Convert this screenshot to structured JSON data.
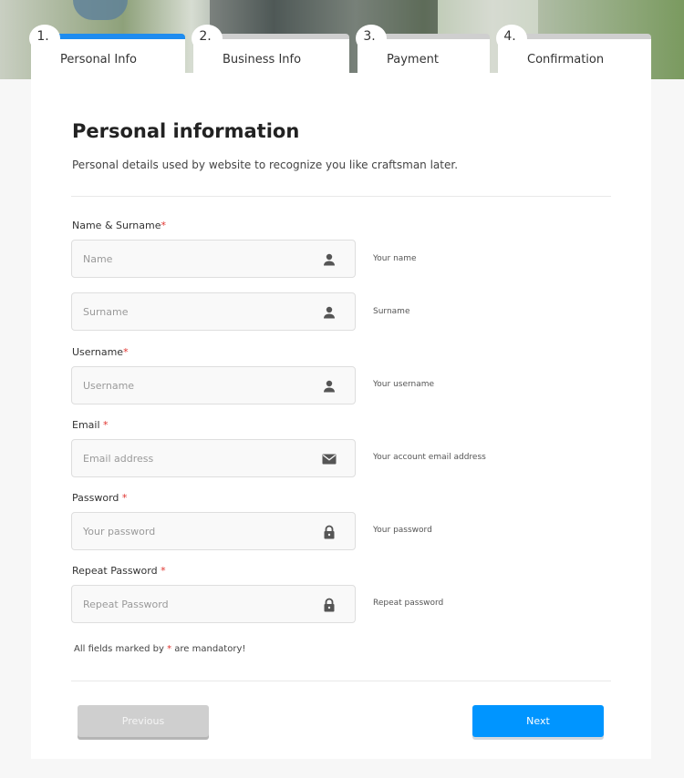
{
  "steps": [
    {
      "number": "1.",
      "label": "Personal Info",
      "active": true
    },
    {
      "number": "2.",
      "label": "Business Info",
      "active": false
    },
    {
      "number": "3.",
      "label": "Payment",
      "active": false
    },
    {
      "number": "4.",
      "label": "Confirmation",
      "active": false
    }
  ],
  "form": {
    "title": "Personal information",
    "subtitle": "Personal details used by website to recognize you like craftsman later.",
    "labels": {
      "name_surname": "Name & Surname",
      "username": "Username",
      "email": "Email ",
      "password": "Password ",
      "repeat_password": "Repeat Password "
    },
    "required_marker": "*",
    "fields": {
      "name": {
        "placeholder": "Name",
        "value": "",
        "hint": "Your name",
        "icon": "user-icon"
      },
      "surname": {
        "placeholder": "Surname",
        "value": "",
        "hint": "Surname",
        "icon": "user-icon"
      },
      "username": {
        "placeholder": "Username",
        "value": "",
        "hint": "Your username",
        "icon": "user-icon"
      },
      "email": {
        "placeholder": "Email address",
        "value": "",
        "hint": "Your account email address",
        "icon": "envelope-icon"
      },
      "password": {
        "placeholder": "Your password",
        "value": "",
        "hint": "Your password",
        "icon": "lock-icon"
      },
      "repeat_password": {
        "placeholder": "Repeat Password",
        "value": "",
        "hint": "Repeat password",
        "icon": "lock-icon"
      }
    },
    "mandatory_note_before": "All fields marked by ",
    "mandatory_note_after": " are mandatory!"
  },
  "buttons": {
    "previous": "Previous",
    "next": "Next"
  },
  "colors": {
    "accent": "#1e8cf0",
    "next_button": "#0095ff",
    "required": "#e0342f",
    "disabled_button": "#cfcfcf"
  }
}
